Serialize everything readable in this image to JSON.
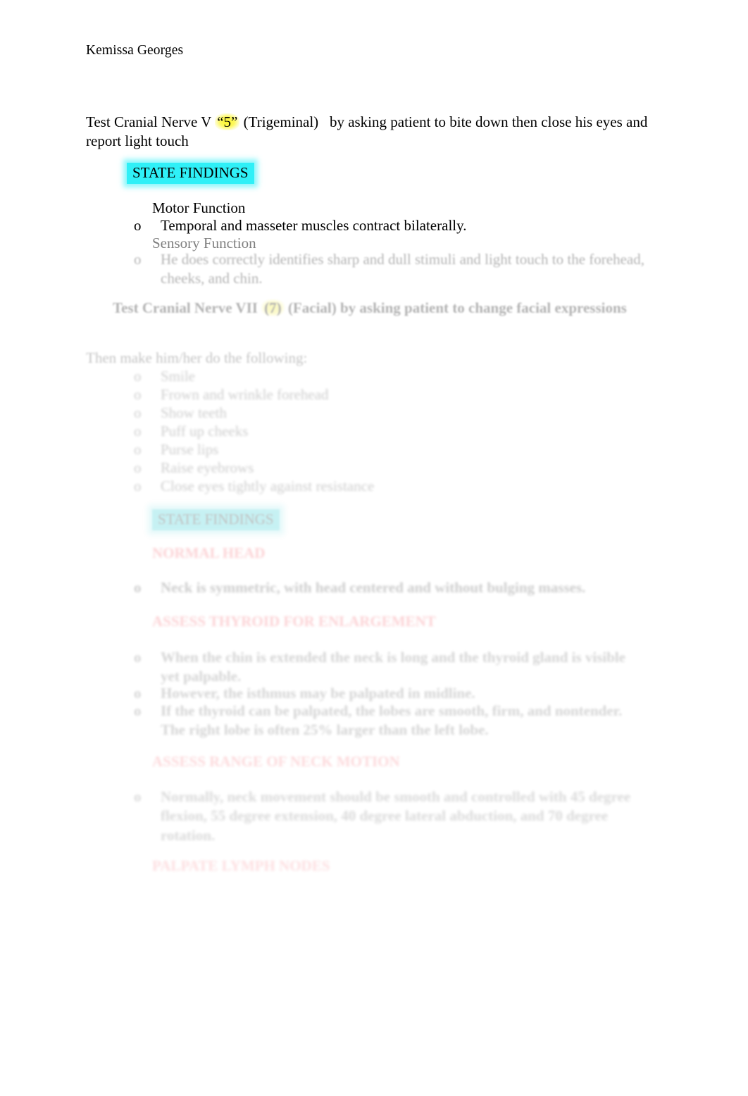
{
  "document": {
    "author": "Kemissa Georges"
  },
  "section_cn5": {
    "heading_pre": "Test Cranial Nerve V",
    "heading_highlight": "“5”",
    "heading_mid": "(Trigeminal)",
    "heading_post": "by asking patient to bite down then close his eyes and report light touch",
    "state_findings_label": "STATE FINDINGS",
    "motor_heading": "Motor Function",
    "motor_bullet_mark": "o",
    "motor_bullet_text": "Temporal and masseter muscles contract bilaterally.",
    "sensory_heading": "Sensory Function",
    "sensory_bullet_mark": "o",
    "sensory_bullet_text": "He does correctly identifies sharp and dull stimuli and light touch to the forehead, cheeks, and chin."
  },
  "section_cn7": {
    "heading_pre": "Test Cranial Nerve VII",
    "heading_highlight": "(7)",
    "heading_mid": "(Facial)",
    "heading_post": "by asking patient to change facial expressions",
    "instruction": "Then make him/her do the following:",
    "list_mark": "o",
    "list_items": [
      "Smile",
      "Frown and wrinkle forehead",
      "Show teeth",
      "Puff up cheeks",
      "Purse lips",
      "Raise eyebrows",
      "Close eyes tightly against resistance"
    ],
    "state_findings_label": "STATE FINDINGS",
    "normal_head_label": "NORMAL HEAD"
  },
  "section_neck": {
    "bullet_mark": "o",
    "symmetry_text": "Neck is symmetric, with head centered and without bulging masses.",
    "assess_thyroid_label": "ASSESS THYROID FOR ENLARGEMENT",
    "items": [
      "When the chin is extended the neck is long and the thyroid gland is visible yet palpable.",
      "However, the isthmus may be palpated in midline.",
      "If the thyroid can be palpated, the lobes are smooth, firm, and nontender. The right lobe is often 25% larger than the left lobe."
    ],
    "assess_rom_label": "ASSESS RANGE OF NECK MOTION",
    "rom_text": "Normally, neck movement should be smooth and controlled with 45 degree flexion, 55 degree extension, 40 degree lateral abduction, and 70 degree rotation.",
    "palpate_nodes_label": "PALPATE LYMPH NODES"
  },
  "colors": {
    "highlight_yellow": "#fbf52a",
    "highlight_cyan": "#2ff0f7",
    "annotation_red": "#e8121d",
    "text": "#000000"
  }
}
